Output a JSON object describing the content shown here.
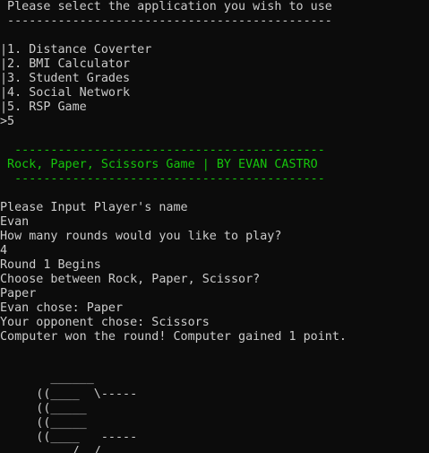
{
  "colors": {
    "background": "#0c0c0c",
    "text": "#cccccc",
    "accent_green": "#16c60c"
  },
  "console": {
    "lines": [
      " Please select the application you wish to use",
      " ---------------------------------------------",
      "",
      "|1. Distance Coverter",
      "|2. BMI Calculator",
      "|3. Student Grades",
      "|4. Social Network",
      "|5. RSP Game",
      ">5",
      "",
      "  -------------------------------------------",
      " Rock, Paper, Scissors Game | BY EVAN CASTRO",
      "  -------------------------------------------",
      "",
      "Please Input Player's name",
      "Evan",
      "How many rounds would you like to play?",
      "4",
      "Round 1 Begins",
      "Choose between Rock, Paper, Scissor?",
      "Paper",
      "Evan chose: Paper",
      "Your opponent chose: Scissors",
      "Computer won the round! Computer gained 1 point.",
      "",
      "",
      "       ______",
      "     ((____  \\-----",
      "     ((_____",
      "     ((_____",
      "     ((____   -----",
      "          /  /"
    ]
  }
}
